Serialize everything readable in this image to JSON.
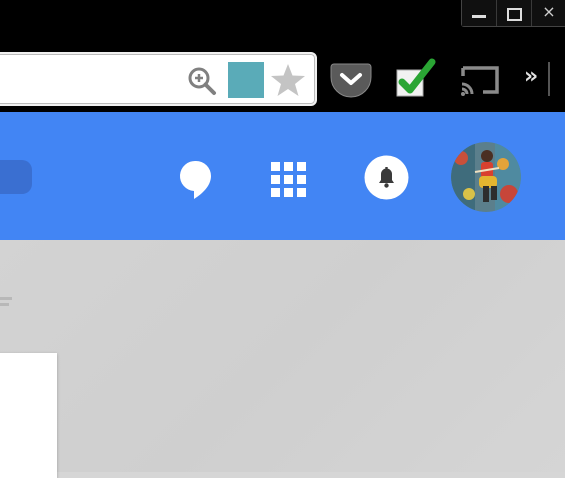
{
  "window_controls": {
    "minimize_label": "",
    "restore_label": "",
    "close_label": "×"
  },
  "omnibox": {
    "zoom_icon": "zoom-in-icon",
    "extension_color": "#5aabb8",
    "bookmark_icon": "star-icon"
  },
  "toolbar": {
    "extensions": [
      "pocket-icon",
      "check-icon",
      "cast-icon"
    ],
    "overflow_label": "»"
  },
  "app_bar": {
    "color": "#4285f4",
    "icons": [
      "hangouts-icon",
      "apps-grid-icon",
      "notifications-icon",
      "avatar"
    ]
  }
}
